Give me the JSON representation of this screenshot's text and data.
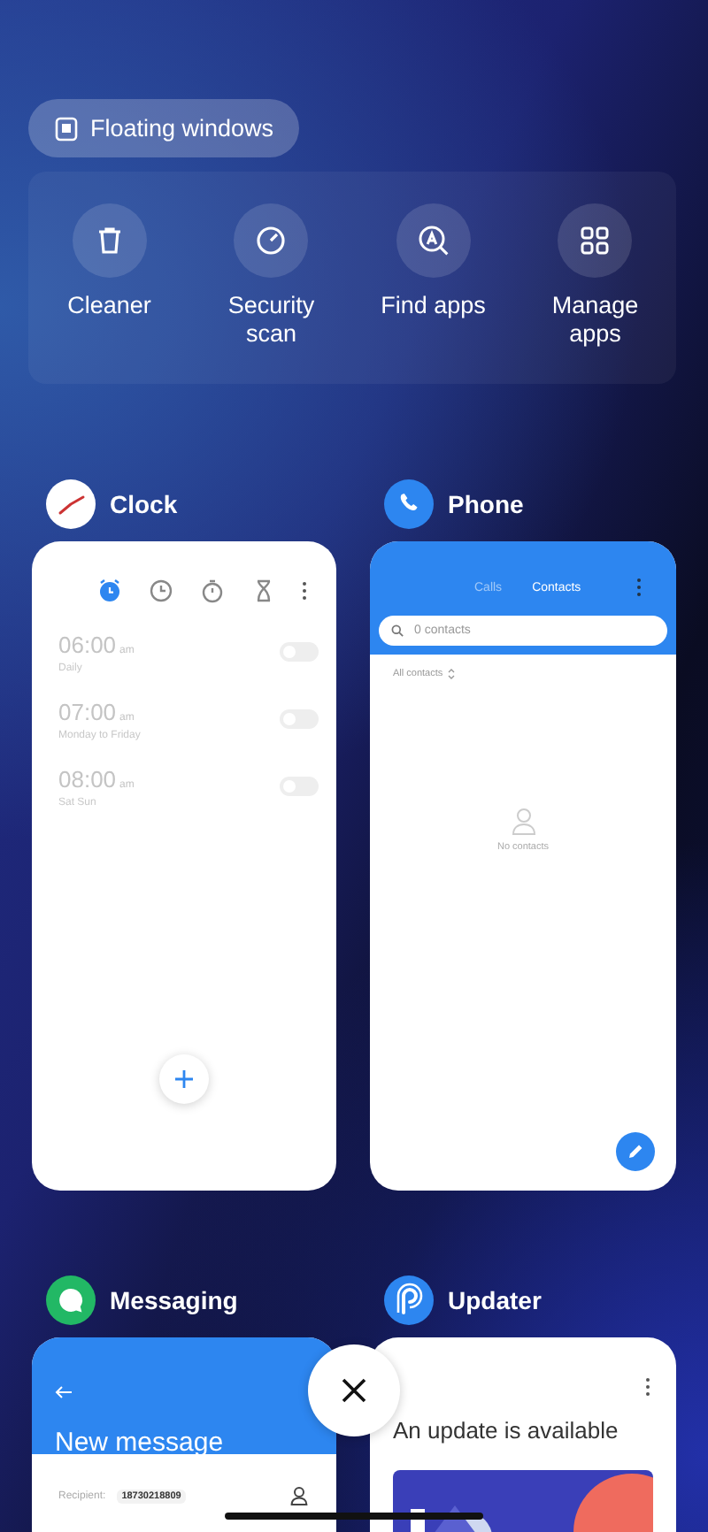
{
  "floating_windows": {
    "label": "Floating windows"
  },
  "quick_actions": [
    {
      "label": "Cleaner"
    },
    {
      "label": "Security scan"
    },
    {
      "label": "Find apps"
    },
    {
      "label": "Manage apps"
    }
  ],
  "apps": [
    {
      "kind": "clock",
      "name": "Clock",
      "tabs": [
        {
          "selected": true
        },
        {
          "selected": false
        },
        {
          "selected": false
        },
        {
          "selected": false
        }
      ],
      "alarms": [
        {
          "time": "06:00",
          "period": "am",
          "repeat": "Daily",
          "on": false
        },
        {
          "time": "07:00",
          "period": "am",
          "repeat": "Monday to Friday",
          "on": false
        },
        {
          "time": "08:00",
          "period": "am",
          "repeat": "Sat Sun",
          "on": false
        }
      ]
    },
    {
      "kind": "phone",
      "name": "Phone",
      "tabs": [
        {
          "label": "Calls",
          "selected": false
        },
        {
          "label": "Contacts",
          "selected": true
        }
      ],
      "search": {
        "placeholder": "0 contacts"
      },
      "filter": "All contacts",
      "empty_text": "No contacts"
    },
    {
      "kind": "messaging",
      "name": "Messaging",
      "title": "New message",
      "recipient_label": "Recipient:",
      "recipient": "18730218809"
    },
    {
      "kind": "updater",
      "name": "Updater",
      "title": "An update is available"
    }
  ]
}
